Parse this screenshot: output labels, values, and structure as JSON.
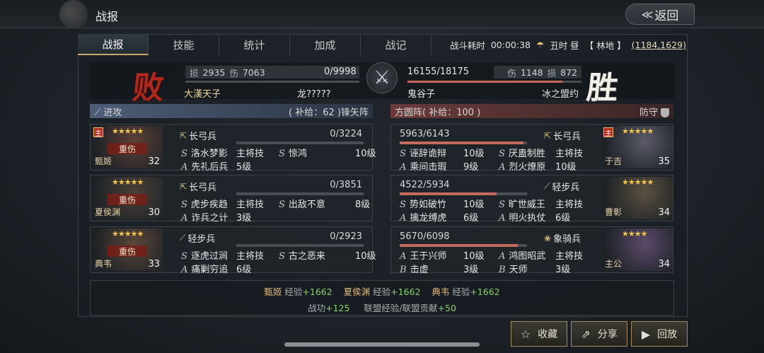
{
  "header": {
    "title": "战报",
    "back_label": "返回",
    "back_arrow": "≪"
  },
  "tabs": [
    "战报",
    "技能",
    "统计",
    "加成",
    "战记"
  ],
  "battle_info": {
    "duration_label": "战斗耗时",
    "duration": "00:00:38",
    "time": "丑时 昼",
    "terrain": "【 林地 】",
    "coords": "(1184,1629)"
  },
  "result": {
    "lose_char": "败",
    "win_char": "胜",
    "left": {
      "loss_label": "损",
      "loss": "2935",
      "hurt_label": "伤",
      "hurt": "7063",
      "hp": "0/9998",
      "hp_fraction": 0.0,
      "player": "大漢天子",
      "alliance": "龙?????"
    },
    "right": {
      "hp": "16155/18175",
      "hp_fraction": 0.89,
      "hurt_label": "伤",
      "hurt": "1148",
      "loss_label": "损",
      "loss": "872",
      "player": "鬼谷子",
      "alliance": "冰之盟约"
    }
  },
  "left_side": {
    "mode": "进攻",
    "supply": "( 补给：62 )",
    "formation": "锋矢阵"
  },
  "right_side": {
    "formation": "方圆阵",
    "supply": "( 补给：100 )",
    "mode": "防守"
  },
  "left_generals": [
    {
      "name": "甄姬",
      "level": "32",
      "stars": "★★★★★",
      "main": "主",
      "wounded": "重伤",
      "troop": "长弓兵",
      "troop_icon": "⇱",
      "hp": "0/3224",
      "hp_fraction": 0.0,
      "skills": [
        {
          "type": "S",
          "name": "洛水梦影",
          "lv": "主将技"
        },
        {
          "type": "S",
          "name": "惊鸿",
          "lv": "10级"
        },
        {
          "type": "A",
          "name": "先礼后兵",
          "lv": "5级"
        }
      ]
    },
    {
      "name": "夏侯渊",
      "level": "30",
      "stars": "★★★★★",
      "main": "",
      "wounded": "重伤",
      "troop": "长弓兵",
      "troop_icon": "⇱",
      "hp": "0/3851",
      "hp_fraction": 0.0,
      "skills": [
        {
          "type": "S",
          "name": "虎步疾趋",
          "lv": "主将技"
        },
        {
          "type": "S",
          "name": "出敌不意",
          "lv": "8级"
        },
        {
          "type": "A",
          "name": "诈兵之计",
          "lv": "3级"
        }
      ]
    },
    {
      "name": "典韦",
      "level": "33",
      "stars": "★★★★★",
      "main": "",
      "wounded": "重伤",
      "troop": "轻步兵",
      "troop_icon": "⟋",
      "hp": "0/2923",
      "hp_fraction": 0.0,
      "skills": [
        {
          "type": "S",
          "name": "逐虎过涧",
          "lv": "主将技"
        },
        {
          "type": "S",
          "name": "古之恶来",
          "lv": "10级"
        },
        {
          "type": "A",
          "name": "痛剿穷追",
          "lv": "6级"
        }
      ]
    }
  ],
  "right_generals": [
    {
      "name": "于吉",
      "level": "35",
      "stars": "★★★★★",
      "main": "主",
      "troop": "长弓兵",
      "troop_icon": "⇱",
      "hp": "5963/6143",
      "hp_fraction": 0.97,
      "skills": [
        {
          "type": "S",
          "name": "诬辞诡辩",
          "lv": "10级"
        },
        {
          "type": "S",
          "name": "厌蛊制胜",
          "lv": "主将技"
        },
        {
          "type": "A",
          "name": "乘间击瑕",
          "lv": "9级"
        },
        {
          "type": "A",
          "name": "烈火燎原",
          "lv": "10级"
        }
      ]
    },
    {
      "name": "曹彰",
      "level": "34",
      "stars": "★★★★★",
      "main": "",
      "troop": "轻步兵",
      "troop_icon": "⟋",
      "hp": "4522/5934",
      "hp_fraction": 0.76,
      "skills": [
        {
          "type": "S",
          "name": "势如破竹",
          "lv": "10级"
        },
        {
          "type": "S",
          "name": "旷世威王",
          "lv": "主将技"
        },
        {
          "type": "A",
          "name": "擒龙缚虎",
          "lv": "6级"
        },
        {
          "type": "A",
          "name": "明火执仗",
          "lv": "6级"
        }
      ]
    },
    {
      "name": "主公",
      "level": "34",
      "stars": "★★★★",
      "main": "",
      "troop": "象骑兵",
      "troop_icon": "❀",
      "hp": "5670/6098",
      "hp_fraction": 0.93,
      "skills": [
        {
          "type": "A",
          "name": "王于兴师",
          "lv": "10级"
        },
        {
          "type": "A",
          "name": "鸿图昭武",
          "lv": "主将技"
        },
        {
          "type": "B",
          "name": "击虚",
          "lv": "3级"
        },
        {
          "type": "B",
          "name": "天师",
          "lv": "3级"
        }
      ]
    }
  ],
  "experience": {
    "label": "经验",
    "items": [
      {
        "name": "甄姬",
        "value": "+1662"
      },
      {
        "name": "夏侯渊",
        "value": "+1662"
      },
      {
        "name": "典韦",
        "value": "+1662"
      }
    ],
    "merit_label": "战功",
    "merit": "+125",
    "alliance_label": "联盟经验/联盟贡献",
    "alliance": "+50"
  },
  "buttons": {
    "collect": "收藏",
    "share": "分享",
    "replay": "回放"
  }
}
